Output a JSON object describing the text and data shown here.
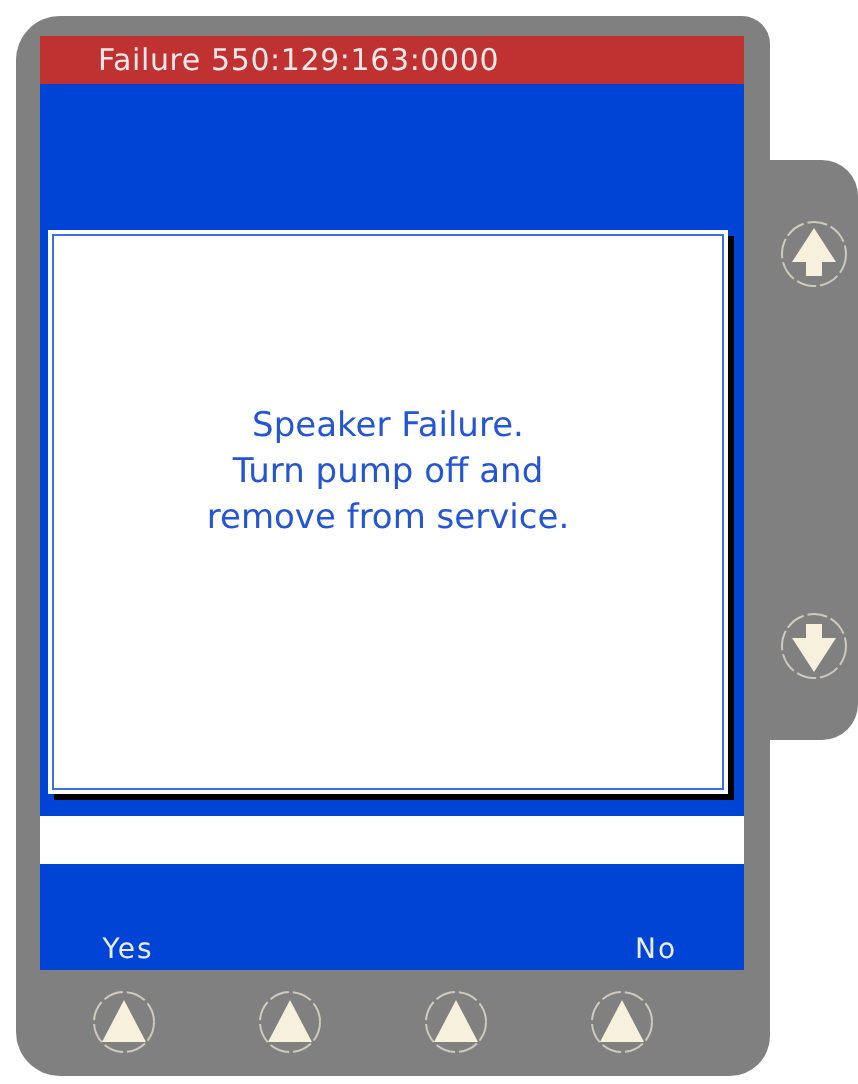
{
  "title_bar": {
    "text": "Failure 550:129:163:0000"
  },
  "dialog": {
    "lines": [
      "Speaker Failure.",
      "Turn pump off and",
      "remove from service."
    ]
  },
  "left_softkey": {
    "label": "Yes"
  },
  "right_softkey": {
    "label": "No"
  }
}
